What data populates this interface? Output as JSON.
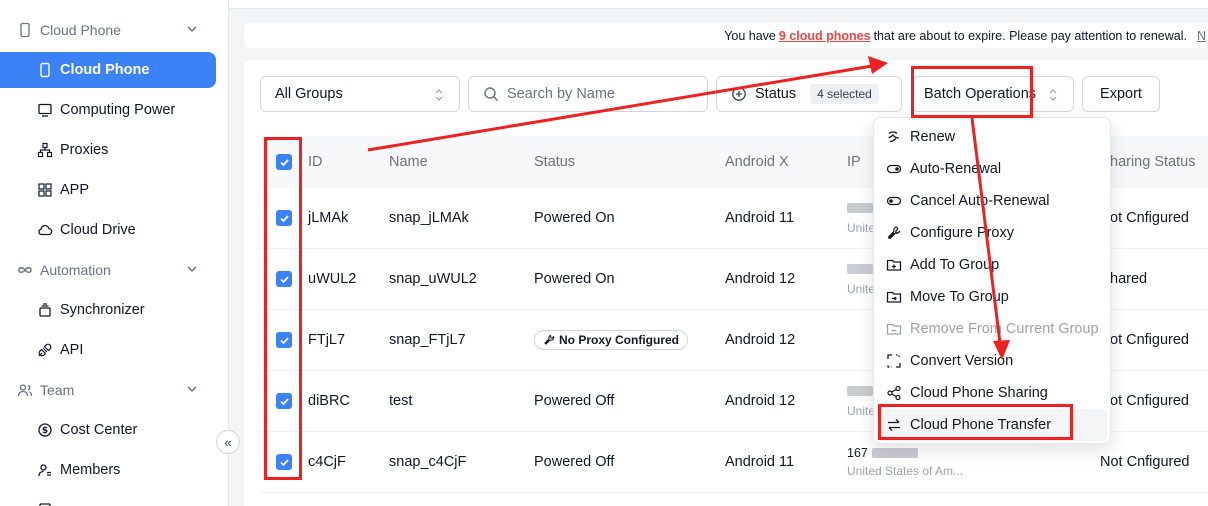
{
  "sidebar": {
    "groups": [
      {
        "label": "Cloud Phone"
      },
      {
        "label": "Automation"
      },
      {
        "label": "Team"
      }
    ],
    "items": [
      {
        "label": "Cloud Phone",
        "active": true
      },
      {
        "label": "Computing Power"
      },
      {
        "label": "Proxies"
      },
      {
        "label": "APP"
      },
      {
        "label": "Cloud Drive"
      },
      {
        "label": "Synchronizer"
      },
      {
        "label": "API"
      },
      {
        "label": "Cost Center"
      },
      {
        "label": "Members"
      }
    ],
    "collapse_glyph": "«"
  },
  "notice": {
    "prefix": "You have",
    "highlight": "9 cloud phones",
    "suffix": "that are about to expire. Please pay attention to renewal.",
    "more": "N"
  },
  "toolbar": {
    "group_select": "All Groups",
    "search_placeholder": "Search by Name",
    "status_label": "Status",
    "status_badge": "4 selected",
    "batch_label": "Batch Operations",
    "export_label": "Export"
  },
  "table": {
    "columns": [
      "ID",
      "Name",
      "Status",
      "Android X",
      "IP",
      "haring Status"
    ],
    "rows": [
      {
        "id": "jLMAk",
        "name": "snap_jLMAk",
        "status": "Powered On",
        "android": "Android 11",
        "ip_sub": "Unite",
        "sharing": "ot Cnfigured"
      },
      {
        "id": "uWUL2",
        "name": "snap_uWUL2",
        "status": "Powered On",
        "android": "Android 12",
        "ip_sub": "Unite",
        "sharing": "hared"
      },
      {
        "id": "FTjL7",
        "name": "snap_FTjL7",
        "status": "No Proxy Configured",
        "android": "Android 12",
        "ip_sub": "",
        "sharing": "ot Cnfigured"
      },
      {
        "id": "diBRC",
        "name": "test",
        "status": "Powered Off",
        "android": "Android 12",
        "ip_sub": "Unite",
        "sharing": "ot Cnfigured"
      },
      {
        "id": "c4CjF",
        "name": "snap_c4CjF",
        "status": "Powered Off",
        "android": "Android 11",
        "ip_prefix": "167",
        "ip_sub": "United States of Am...",
        "sharing": "Not Cnfigured"
      }
    ]
  },
  "batch_menu": {
    "items": [
      {
        "label": "Renew",
        "icon": "renew-icon"
      },
      {
        "label": "Auto-Renewal",
        "icon": "toggle-on-icon"
      },
      {
        "label": "Cancel Auto-Renewal",
        "icon": "toggle-off-icon"
      },
      {
        "label": "Configure Proxy",
        "icon": "wrench-icon"
      },
      {
        "label": "Add To Group",
        "icon": "folder-add-icon"
      },
      {
        "label": "Move To Group",
        "icon": "folder-move-icon"
      },
      {
        "label": "Remove From Current Group",
        "icon": "folder-remove-icon",
        "disabled": true
      },
      {
        "label": "Convert Version",
        "icon": "convert-icon"
      },
      {
        "label": "Cloud Phone Sharing",
        "icon": "share-icon"
      },
      {
        "label": "Cloud Phone Transfer",
        "icon": "transfer-icon",
        "highlighted": true
      }
    ]
  },
  "colors": {
    "accent": "#3b82f6",
    "annotation": "#ef2020"
  }
}
